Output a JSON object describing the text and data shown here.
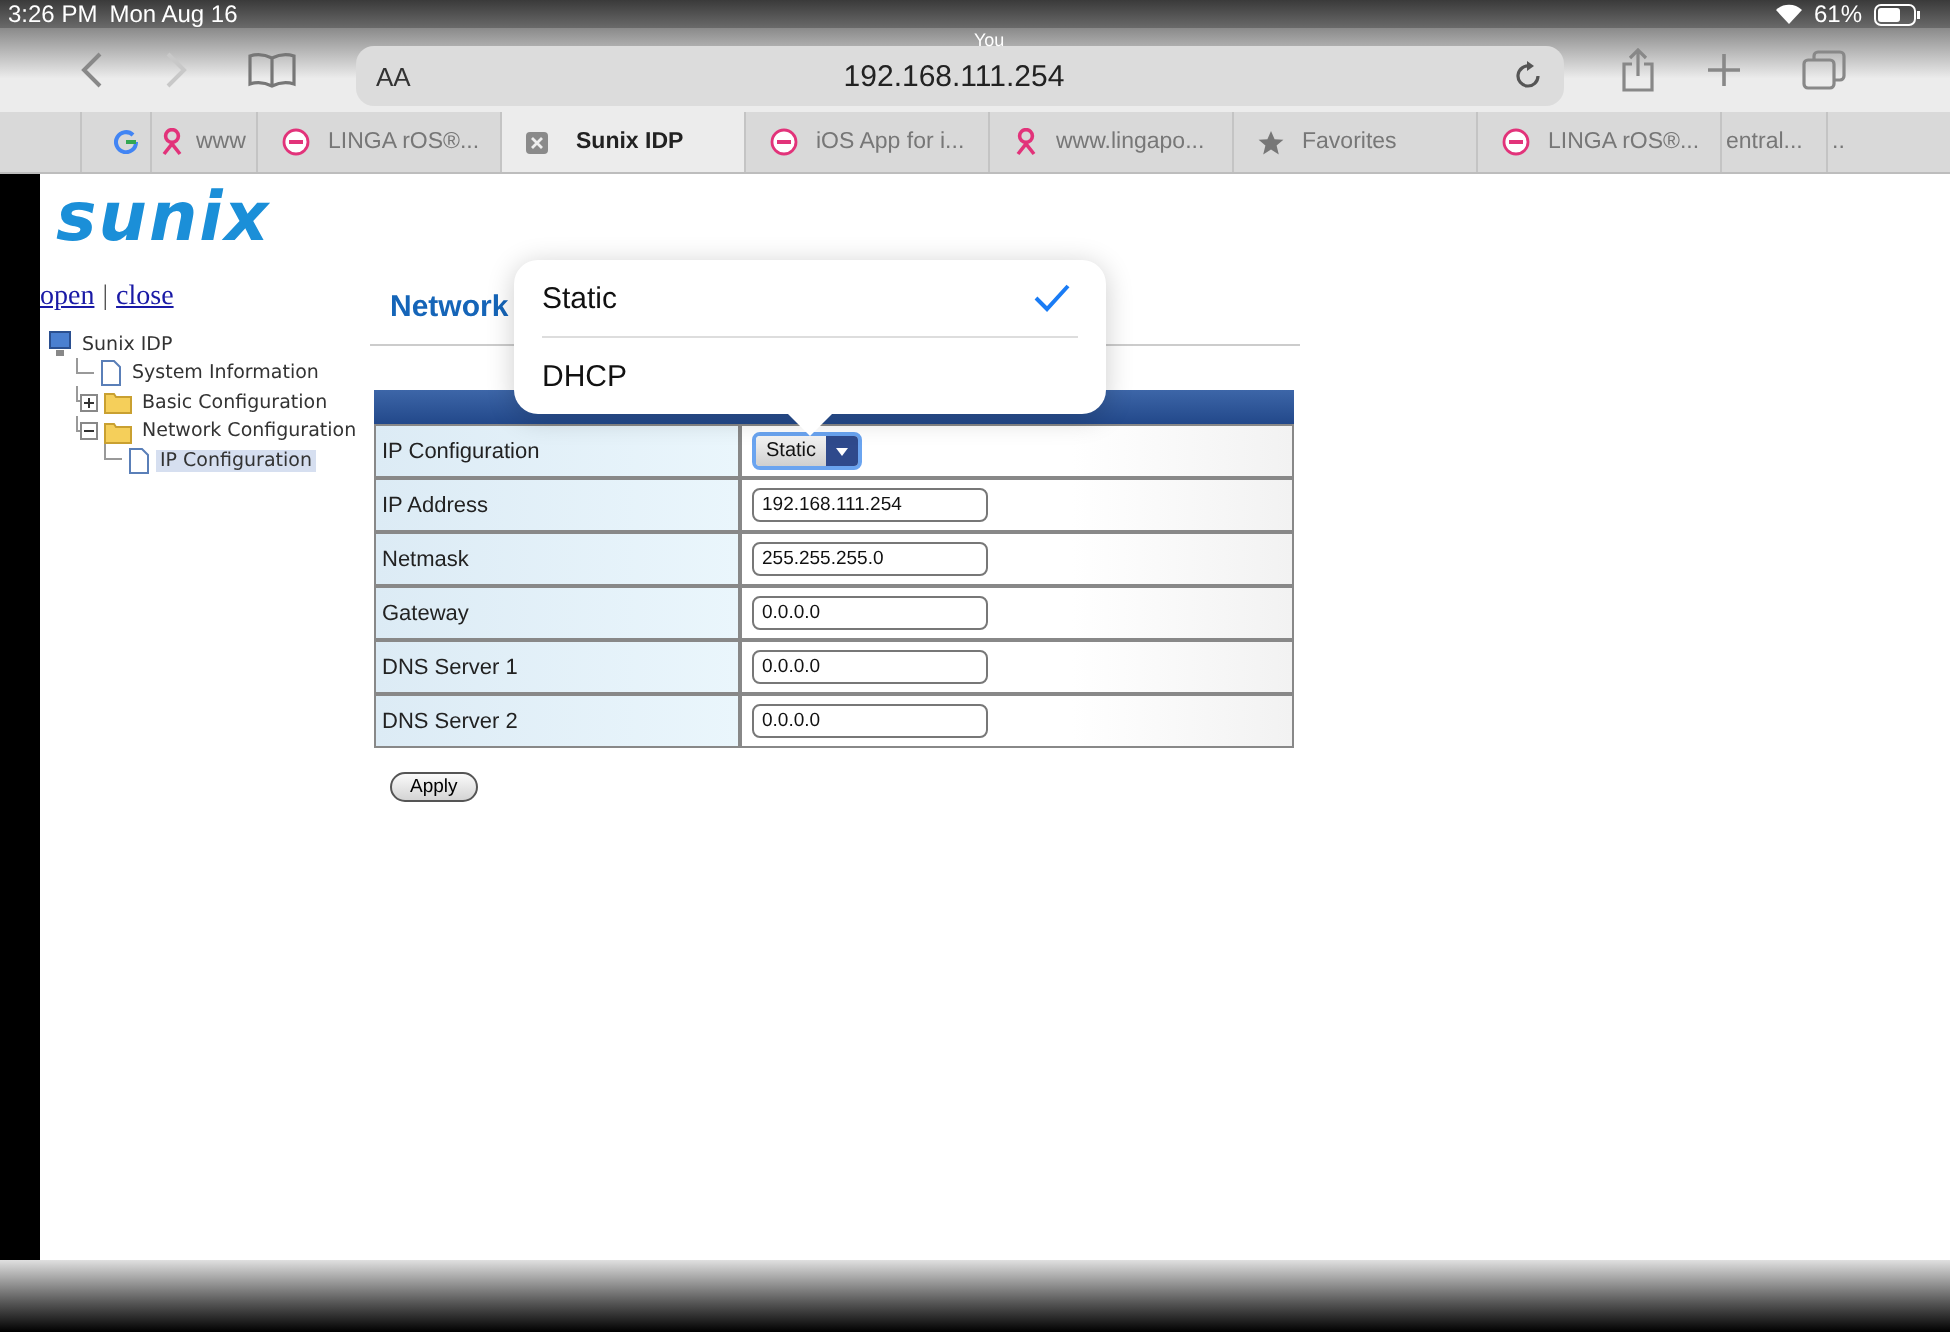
{
  "status_bar": {
    "time": "3:26 PM",
    "date": "Mon Aug 16",
    "battery": "61%"
  },
  "toolbar": {
    "label": "You",
    "reader_button": "AA",
    "url": "192.168.111.254",
    "forward_disabled": true
  },
  "tabs": [
    {
      "kind": "google",
      "selected": false
    },
    {
      "label": "www",
      "kind": "figure",
      "selected": false
    },
    {
      "label": "LINGA rOS®...",
      "kind": "linga",
      "selected": false
    },
    {
      "label": "Sunix IDP",
      "kind": "close",
      "selected": true
    },
    {
      "label": "iOS App for i...",
      "kind": "linga",
      "selected": false
    },
    {
      "label": "www.lingapo...",
      "kind": "figure",
      "selected": false
    },
    {
      "label": "Favorites",
      "kind": "star",
      "selected": false
    },
    {
      "label": "LINGA rOS®...",
      "kind": "linga",
      "selected": false
    },
    {
      "label": "entral...",
      "selected": false
    },
    {
      "label": "..",
      "selected": false
    }
  ],
  "page": {
    "logo": "sunix",
    "links": [
      "open",
      "close"
    ],
    "separator": "|",
    "tree": [
      {
        "label": "Sunix IDP",
        "kind": "computer",
        "selected": false,
        "children": [
          {
            "label": "System Information",
            "kind": "page",
            "selected": false
          },
          {
            "label": "Basic Configuration",
            "kind": "folder",
            "expanded": false,
            "selected": false
          },
          {
            "label": "Network Configuration",
            "kind": "folder",
            "expanded": true,
            "selected": false,
            "children": [
              {
                "label": "IP Configuration",
                "kind": "page",
                "selected": true
              }
            ]
          }
        ]
      }
    ],
    "heading": "Network",
    "form": [
      {
        "label": "IP Configuration",
        "kind": "select",
        "value": "Static"
      },
      {
        "label": "IP Address",
        "kind": "input",
        "value": "192.168.111.254"
      },
      {
        "label": "Netmask",
        "kind": "input",
        "value": "255.255.255.0"
      },
      {
        "label": "Gateway",
        "kind": "input",
        "value": "0.0.0.0"
      },
      {
        "label": "DNS Server 1",
        "kind": "input",
        "value": "0.0.0.0"
      },
      {
        "label": "DNS Server 2",
        "kind": "input",
        "value": "0.0.0.0"
      }
    ],
    "apply": "Apply"
  },
  "picker": {
    "options": [
      {
        "label": "Static",
        "selected": true
      },
      {
        "label": "DHCP",
        "selected": false
      }
    ]
  }
}
